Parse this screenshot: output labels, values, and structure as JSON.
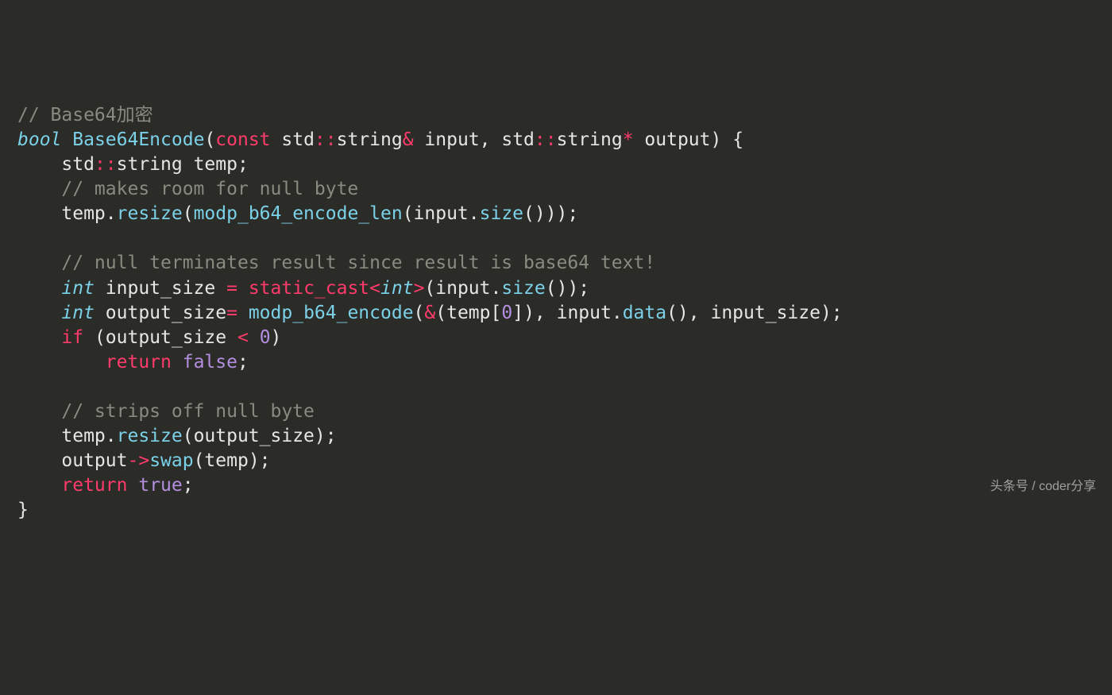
{
  "colors": {
    "background": "#2b2b27",
    "comment": "#8a8a80",
    "keyword": "#ff3b6b",
    "type": "#7bd1e8",
    "func": "#7bd1e8",
    "operator": "#ff3b6b",
    "constant": "#b48ee0",
    "foreground": "#e6e6e6"
  },
  "watermark": "头条号 / coder分享",
  "code": {
    "lines": [
      [
        {
          "cls": "comment",
          "text": "// Base64加密"
        }
      ],
      [
        {
          "cls": "type",
          "text": "bool"
        },
        {
          "cls": "ident",
          "text": " "
        },
        {
          "cls": "func",
          "text": "Base64Encode"
        },
        {
          "cls": "punct",
          "text": "("
        },
        {
          "cls": "keyword",
          "text": "const"
        },
        {
          "cls": "ident",
          "text": " std"
        },
        {
          "cls": "op",
          "text": "::"
        },
        {
          "cls": "ident",
          "text": "string"
        },
        {
          "cls": "op",
          "text": "&"
        },
        {
          "cls": "ident",
          "text": " input, std"
        },
        {
          "cls": "op",
          "text": "::"
        },
        {
          "cls": "ident",
          "text": "string"
        },
        {
          "cls": "op",
          "text": "*"
        },
        {
          "cls": "ident",
          "text": " output"
        },
        {
          "cls": "punct",
          "text": ") {"
        }
      ],
      [
        {
          "cls": "ident",
          "text": "    std"
        },
        {
          "cls": "op",
          "text": "::"
        },
        {
          "cls": "ident",
          "text": "string temp;"
        }
      ],
      [
        {
          "cls": "ident",
          "text": "    "
        },
        {
          "cls": "comment",
          "text": "// makes room for null byte"
        }
      ],
      [
        {
          "cls": "ident",
          "text": "    temp."
        },
        {
          "cls": "func",
          "text": "resize"
        },
        {
          "cls": "punct",
          "text": "("
        },
        {
          "cls": "func",
          "text": "modp_b64_encode_len"
        },
        {
          "cls": "punct",
          "text": "(input."
        },
        {
          "cls": "func",
          "text": "size"
        },
        {
          "cls": "punct",
          "text": "()));"
        }
      ],
      [
        {
          "cls": "ident",
          "text": ""
        }
      ],
      [
        {
          "cls": "ident",
          "text": "    "
        },
        {
          "cls": "comment",
          "text": "// null terminates result since result is base64 text!"
        }
      ],
      [
        {
          "cls": "ident",
          "text": "    "
        },
        {
          "cls": "type",
          "text": "int"
        },
        {
          "cls": "ident",
          "text": " input_size "
        },
        {
          "cls": "op",
          "text": "="
        },
        {
          "cls": "ident",
          "text": " "
        },
        {
          "cls": "keyword",
          "text": "static_cast"
        },
        {
          "cls": "op",
          "text": "<"
        },
        {
          "cls": "type",
          "text": "int"
        },
        {
          "cls": "op",
          "text": ">"
        },
        {
          "cls": "punct",
          "text": "(input."
        },
        {
          "cls": "func",
          "text": "size"
        },
        {
          "cls": "punct",
          "text": "());"
        }
      ],
      [
        {
          "cls": "ident",
          "text": "    "
        },
        {
          "cls": "type",
          "text": "int"
        },
        {
          "cls": "ident",
          "text": " output_size"
        },
        {
          "cls": "op",
          "text": "="
        },
        {
          "cls": "ident",
          "text": " "
        },
        {
          "cls": "func",
          "text": "modp_b64_encode"
        },
        {
          "cls": "punct",
          "text": "("
        },
        {
          "cls": "op",
          "text": "&"
        },
        {
          "cls": "punct",
          "text": "(temp["
        },
        {
          "cls": "number",
          "text": "0"
        },
        {
          "cls": "punct",
          "text": "]), input."
        },
        {
          "cls": "func",
          "text": "data"
        },
        {
          "cls": "punct",
          "text": "(), input_size);"
        }
      ],
      [
        {
          "cls": "ident",
          "text": "    "
        },
        {
          "cls": "keyword",
          "text": "if"
        },
        {
          "cls": "ident",
          "text": " (output_size "
        },
        {
          "cls": "op",
          "text": "<"
        },
        {
          "cls": "ident",
          "text": " "
        },
        {
          "cls": "number",
          "text": "0"
        },
        {
          "cls": "punct",
          "text": ")"
        }
      ],
      [
        {
          "cls": "ident",
          "text": "        "
        },
        {
          "cls": "keyword",
          "text": "return"
        },
        {
          "cls": "ident",
          "text": " "
        },
        {
          "cls": "const",
          "text": "false"
        },
        {
          "cls": "punct",
          "text": ";"
        }
      ],
      [
        {
          "cls": "ident",
          "text": ""
        }
      ],
      [
        {
          "cls": "ident",
          "text": "    "
        },
        {
          "cls": "comment",
          "text": "// strips off null byte"
        }
      ],
      [
        {
          "cls": "ident",
          "text": "    temp."
        },
        {
          "cls": "func",
          "text": "resize"
        },
        {
          "cls": "punct",
          "text": "(output_size);"
        }
      ],
      [
        {
          "cls": "ident",
          "text": "    output"
        },
        {
          "cls": "op",
          "text": "->"
        },
        {
          "cls": "func",
          "text": "swap"
        },
        {
          "cls": "punct",
          "text": "(temp);"
        }
      ],
      [
        {
          "cls": "ident",
          "text": "    "
        },
        {
          "cls": "keyword",
          "text": "return"
        },
        {
          "cls": "ident",
          "text": " "
        },
        {
          "cls": "const",
          "text": "true"
        },
        {
          "cls": "punct",
          "text": ";"
        }
      ],
      [
        {
          "cls": "punct",
          "text": "}"
        }
      ]
    ]
  }
}
